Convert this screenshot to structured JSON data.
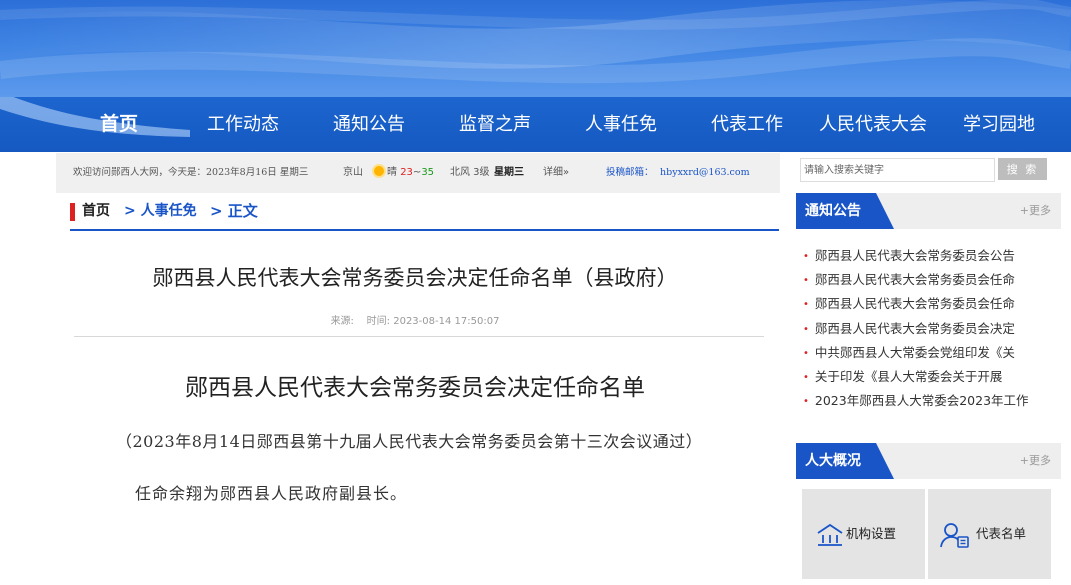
{
  "nav": {
    "items": [
      "首页",
      "工作动态",
      "通知公告",
      "监督之声",
      "人事任免",
      "代表工作",
      "人民代表大会",
      "学习园地"
    ],
    "active_index": 0
  },
  "infobar": {
    "welcome": "欢迎访问郧西人大网，今天是：2023年8月16日 星期三",
    "city": "京山",
    "weather": "晴",
    "temp_low": "23",
    "temp_sep": "~",
    "temp_high": "35",
    "wind": "北风 3级",
    "weekday": "星期三",
    "detail_link": "详细»",
    "mail_label": "投稿邮箱：",
    "mail": "hbyxxrd@163.com"
  },
  "breadcrumb": {
    "home": "首页",
    "category": "> 人事任免",
    "current": "> 正文"
  },
  "article": {
    "title": "郧西县人民代表大会常务委员会决定任命名单（县政府）",
    "source_label": "来源:",
    "time_label": "时间:",
    "time": "2023-08-14 17:50:07",
    "doc_title": "郧西县人民代表大会常务委员会决定任命名单",
    "doc_sub": "（2023年8月14日郧西县第十九届人民代表大会常务委员会第十三次会议通过）",
    "doc_body": "任命余翔为郧西县人民政府副县长。"
  },
  "search": {
    "placeholder": "请输入搜索关键字",
    "button": "搜 索"
  },
  "sidebar": {
    "notice": {
      "title": "通知公告",
      "more": "+更多",
      "items": [
        "郧西县人民代表大会常务委员会公告",
        "郧西县人民代表大会常务委员会任命",
        "郧西县人民代表大会常务委员会任命",
        "郧西县人民代表大会常务委员会决定",
        "中共郧西县人大常委会党组印发《关",
        "关于印发《县人大常委会关于开展",
        "2023年郧西县人大常委会2023年工作"
      ]
    },
    "overview": {
      "title": "人大概况",
      "more": "+更多",
      "cards": [
        {
          "label": "机构设置",
          "icon": "building-icon"
        },
        {
          "label": "代表名单",
          "icon": "person-list-icon"
        }
      ]
    }
  },
  "colors": {
    "nav_bg": "#1559c1",
    "accent": "#1a55c8",
    "red": "#dd2222"
  }
}
